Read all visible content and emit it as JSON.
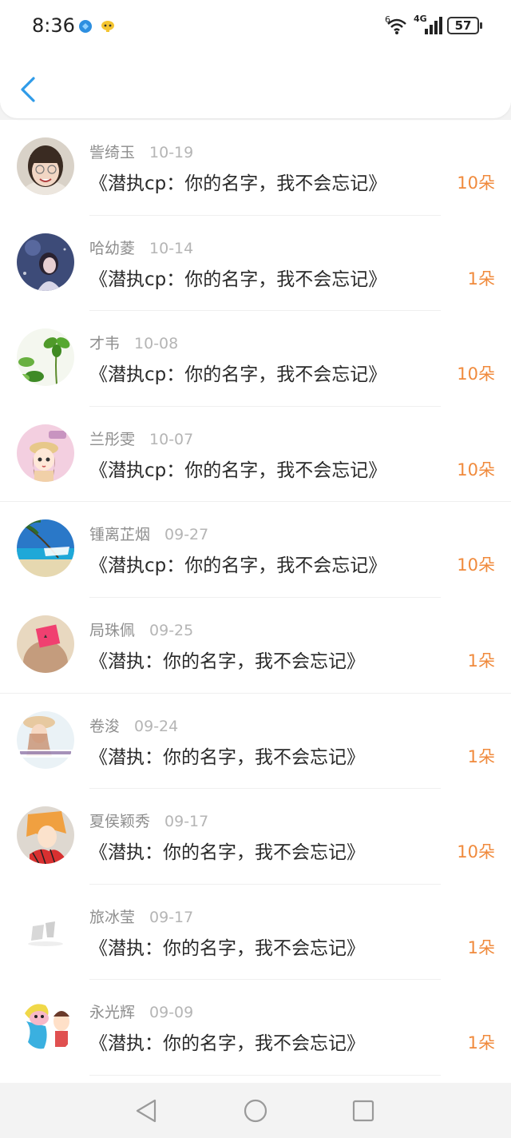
{
  "status_bar": {
    "time": "8:36",
    "battery": "57",
    "network": "4G",
    "wifi_badge": "6",
    "icons": [
      "blue-app-icon",
      "yellow-app-icon",
      "wifi-icon",
      "signal-icon",
      "battery-icon"
    ]
  },
  "nav": {
    "back_icon": "chevron-left-icon",
    "accent": "#2f9be8"
  },
  "list": {
    "accent_count_color": "#f08a3c",
    "items": [
      {
        "name": "訾绮玉",
        "date": "10-19",
        "title": "《潜执cp：你的名字，我不会忘记》",
        "count": "10朵",
        "avatar": "avatar-girl-photo"
      },
      {
        "name": "哈幼菱",
        "date": "10-14",
        "title": "《潜执cp：你的名字，我不会忘记》",
        "count": "1朵",
        "avatar": "avatar-night-girl"
      },
      {
        "name": "才韦",
        "date": "10-08",
        "title": "《潜执cp：你的名字，我不会忘记》",
        "count": "10朵",
        "avatar": "avatar-clover"
      },
      {
        "name": "兰彤雯",
        "date": "10-07",
        "title": "《潜执cp：你的名字，我不会忘记》",
        "count": "10朵",
        "avatar": "avatar-cartoon-girl"
      },
      {
        "name": "锺离芷烟",
        "date": "09-27",
        "title": "《潜执cp：你的名字，我不会忘记》",
        "count": "10朵",
        "avatar": "avatar-beach"
      },
      {
        "name": "局珠佩",
        "date": "09-25",
        "title": "《潜执：你的名字，我不会忘记》",
        "count": "1朵",
        "avatar": "avatar-love-note"
      },
      {
        "name": "卷浚",
        "date": "09-24",
        "title": "《潜执：你的名字，我不会忘记》",
        "count": "1朵",
        "avatar": "avatar-hat-girl"
      },
      {
        "name": "夏侯颖秀",
        "date": "09-17",
        "title": "《潜执：你的名字，我不会忘记》",
        "count": "10朵",
        "avatar": "avatar-anime-boy"
      },
      {
        "name": "旅冰莹",
        "date": "09-17",
        "title": "《潜执：你的名字，我不会忘记》",
        "count": "1朵",
        "avatar": "avatar-sketch"
      },
      {
        "name": "永光辉",
        "date": "09-09",
        "title": "《潜执：你的名字，我不会忘记》",
        "count": "1朵",
        "avatar": "avatar-cartoon-dino"
      }
    ]
  },
  "system_nav": {
    "icons": [
      "back-triangle-icon",
      "home-circle-icon",
      "recents-square-icon"
    ]
  }
}
